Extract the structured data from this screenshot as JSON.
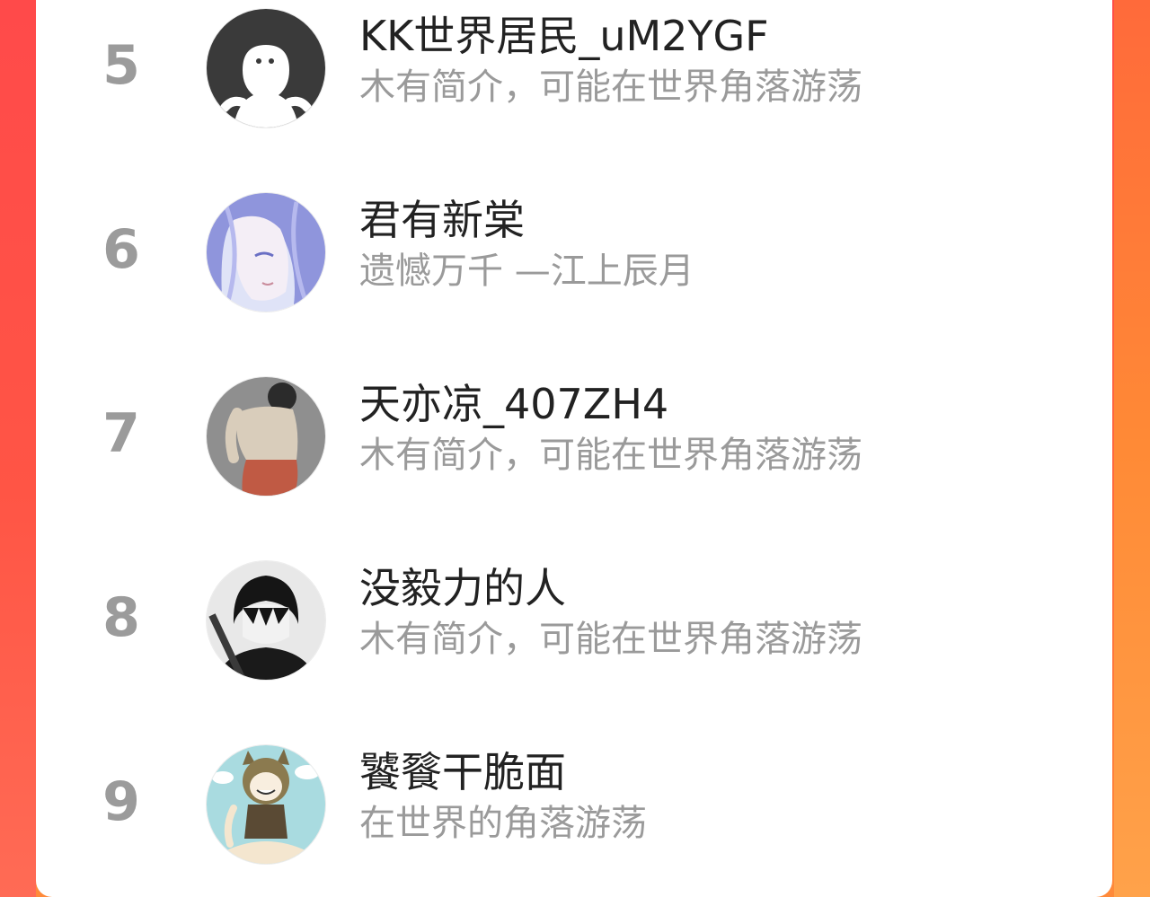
{
  "ranking_list": {
    "items": [
      {
        "rank": "5",
        "name": "KK世界居民_uM2YGF",
        "bio": "木有简介，可能在世界角落游荡",
        "avatar_icon": "default-ghost-avatar-icon"
      },
      {
        "rank": "6",
        "name": "君有新棠",
        "bio": "遗憾万千 —江上辰月",
        "avatar_icon": "anime-girl-avatar-icon"
      },
      {
        "rank": "7",
        "name": "天亦凉_407ZH4",
        "bio": "木有简介，可能在世界角落游荡",
        "avatar_icon": "cartoon-person-avatar-icon"
      },
      {
        "rank": "8",
        "name": "没毅力的人",
        "bio": "木有简介，可能在世界角落游荡",
        "avatar_icon": "dark-hair-boy-avatar-icon"
      },
      {
        "rank": "9",
        "name": "饕餮干脆面",
        "bio": "在世界的角落游荡",
        "avatar_icon": "cat-girl-avatar-icon"
      }
    ]
  },
  "colors": {
    "background_top": "#ff4d46",
    "background_bottom": "#ff8a3a",
    "rank_text": "#9b9b9b",
    "name_text": "#222222",
    "bio_text": "#9a9a9a"
  }
}
